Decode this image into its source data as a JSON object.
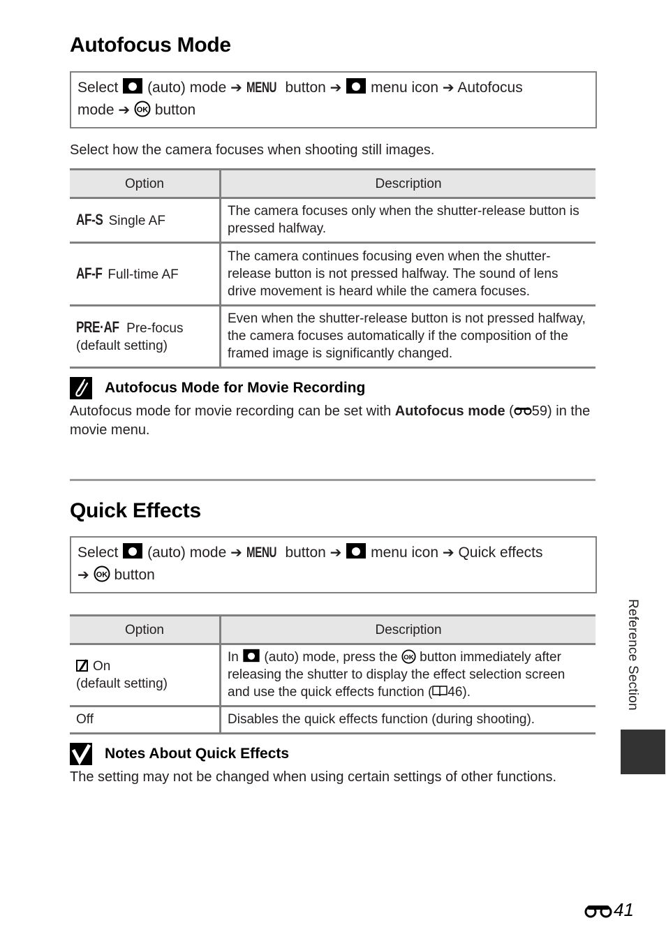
{
  "sections": {
    "autofocus": {
      "title": "Autofocus Mode",
      "path": {
        "select": "Select",
        "auto_mode": "(auto) mode",
        "menu_glyph": "MENU",
        "button": "button",
        "menu_icon": "menu icon",
        "target_a": "Autofocus",
        "target_b": "mode",
        "ok_button": "button"
      },
      "intro": "Select how the camera focuses when shooting still images.",
      "table": {
        "headers": [
          "Option",
          "Description"
        ],
        "rows": [
          {
            "glyph": "AF-S",
            "label": "Single AF",
            "sub": "",
            "description": "The camera focuses only when the shutter-release button is pressed halfway."
          },
          {
            "glyph": "AF-F",
            "label": "Full-time AF",
            "sub": "",
            "description": "The camera continues focusing even when the shutter-release button is not pressed halfway. The sound of lens drive movement is heard while the camera focuses."
          },
          {
            "glyph": "PRE·AF",
            "label": "Pre-focus",
            "sub": "(default setting)",
            "description": "Even when the shutter-release button is not pressed halfway, the camera focuses automatically if the composition of the framed image is significantly changed."
          }
        ]
      },
      "note": {
        "icon": "pencil-note-icon",
        "title": "Autofocus Mode for Movie Recording",
        "body_pre": "Autofocus mode for movie recording can be set with ",
        "body_bold": "Autofocus mode",
        "body_ref_open": " (",
        "body_ref": "59",
        "body_post": ") in the movie menu."
      }
    },
    "quick_effects": {
      "title": "Quick Effects",
      "path": {
        "select": "Select",
        "auto_mode": "(auto) mode",
        "menu_glyph": "MENU",
        "button": "button",
        "menu_icon": "menu icon",
        "target_a": "Quick effects",
        "ok_button": "button"
      },
      "table": {
        "headers": [
          "Option",
          "Description"
        ],
        "rows": [
          {
            "icon": "quick-effects-icon",
            "label": "On",
            "sub": "(default setting)",
            "desc_in": "In",
            "desc_auto": "(auto) mode, press the",
            "desc_rest": "button immediately after releasing the shutter to display the effect selection screen and use the quick effects function (",
            "desc_ref": "46",
            "desc_end": ")."
          },
          {
            "label": "Off",
            "description": "Disables the quick effects function (during shooting)."
          }
        ]
      },
      "note": {
        "icon": "checkmark-caution-icon",
        "title": "Notes About Quick Effects",
        "body": "The setting may not be changed when using certain settings of other functions."
      }
    }
  },
  "sidebar": {
    "label": "Reference Section"
  },
  "footer": {
    "page_number": "41",
    "page_prefix_icon": "binoculars-icon"
  }
}
